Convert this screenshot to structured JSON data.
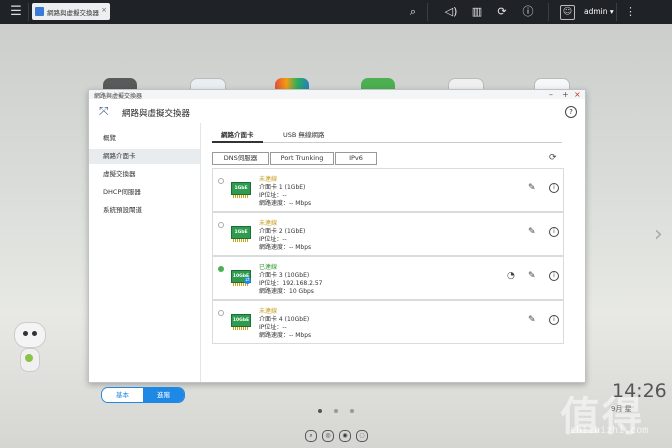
{
  "taskbar": {
    "task_tab_label": "網路與虛擬交換器",
    "task_tab_close": "×",
    "username": "admin ▾"
  },
  "window": {
    "small_title": "網路與虛擬交換器",
    "title": "網路與虛擬交換器",
    "help": "?"
  },
  "sidebar": {
    "items": [
      {
        "label": "概覽"
      },
      {
        "label": "網路介面卡"
      },
      {
        "label": "虛擬交換器"
      },
      {
        "label": "DHCP伺服器"
      },
      {
        "label": "系統預設閘道"
      }
    ],
    "active_index": 1,
    "mode_basic": "基本",
    "mode_advanced": "進階"
  },
  "tabs": [
    {
      "label": "網路介面卡"
    },
    {
      "label": "USB 無線網路"
    }
  ],
  "subtabs": [
    {
      "label": "DNS伺服器"
    },
    {
      "label": "Port Trunking"
    },
    {
      "label": "IPv6"
    }
  ],
  "adapters": [
    {
      "status": "未連線",
      "status_color": "#c9a227",
      "nic_label": "1GbE",
      "name": "介面卡 1 (1GbE)",
      "ip": "IP位址：--",
      "speed": "網路速度：-- Mbps",
      "connected": false
    },
    {
      "status": "未連線",
      "status_color": "#c9a227",
      "nic_label": "1GbE",
      "name": "介面卡 2 (1GbE)",
      "ip": "IP位址：--",
      "speed": "網路速度：-- Mbps",
      "connected": false
    },
    {
      "status": "已連線",
      "status_color": "#3a9a3a",
      "nic_label": "10GbE",
      "name": "介面卡 3 (10GbE)",
      "ip": "IP位址：192.168.2.57",
      "speed": "網路速度：10 Gbps",
      "connected": true
    },
    {
      "status": "未連線",
      "status_color": "#c9a227",
      "nic_label": "10GbE",
      "name": "介面卡 4 (10GbE)",
      "ip": "IP位址：--",
      "speed": "網路速度：-- Mbps",
      "connected": false
    }
  ],
  "desktop": {
    "clock": "14:26",
    "date": "9月 星",
    "watermark": "值得",
    "watermark_url": "zhizhizhi.com"
  },
  "icons": {
    "menu": "hamburger-icon",
    "search": "search-icon",
    "volume": "volume-icon",
    "tasks": "tasks-icon",
    "sync": "sync-icon",
    "info": "info-icon",
    "user": "user-icon",
    "more": "more-icon",
    "edit": "edit-icon",
    "refresh": "refresh-icon"
  },
  "colors": {
    "accent": "#1e88e5",
    "topbar": "#1f2226",
    "nic_green": "#2e9b4f",
    "connected": "#4caf50"
  }
}
